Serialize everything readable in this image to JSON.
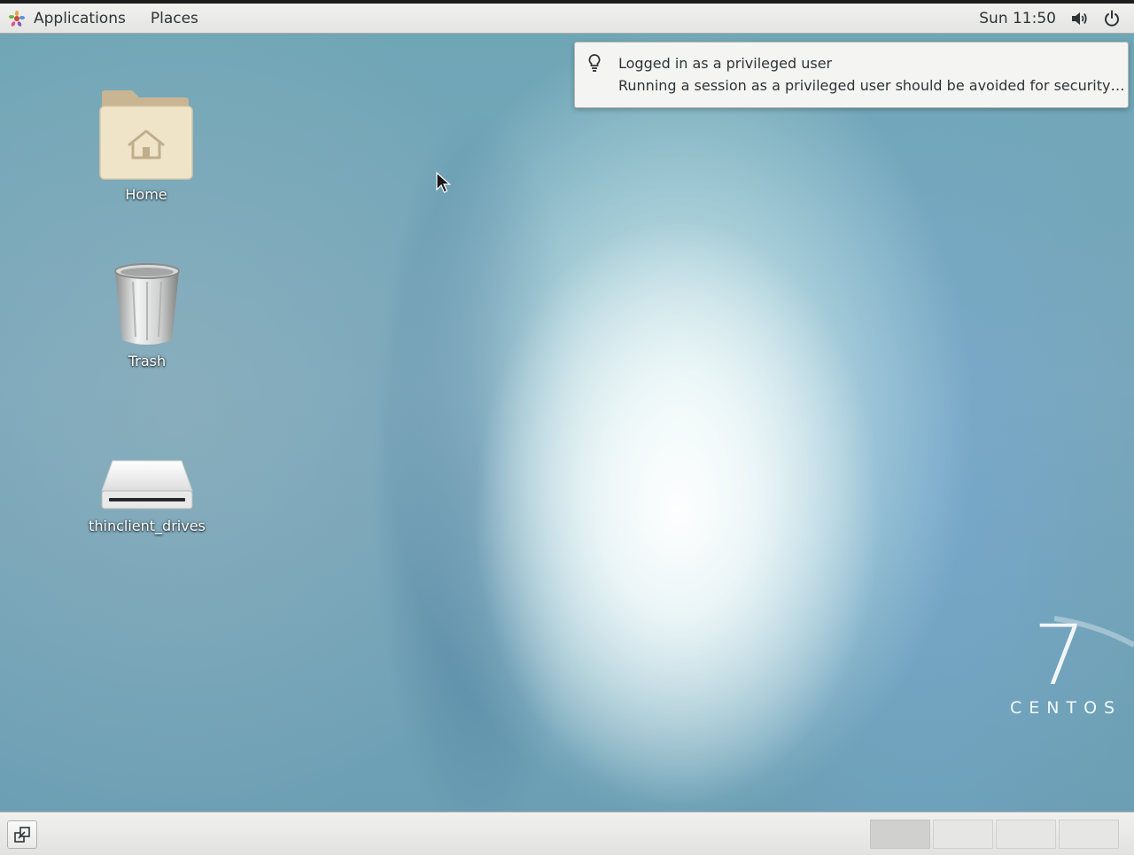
{
  "top_bar": {
    "applications_label": "Applications",
    "places_label": "Places",
    "clock": "Sun 11:50",
    "icons": [
      "gnome-foot-icon",
      "volume-icon",
      "power-icon"
    ]
  },
  "desktop": {
    "icons": [
      {
        "label": "Home",
        "icon": "home-folder-icon"
      },
      {
        "label": "Trash",
        "icon": "trash-icon"
      },
      {
        "label": "thinclient_drives",
        "icon": "drive-icon"
      }
    ],
    "branding": {
      "number": "7",
      "text": "CENTOS"
    }
  },
  "notification": {
    "icon": "lightbulb-icon",
    "title": "Logged in as a privileged user",
    "body": "Running a session as a privileged user should be avoided for security…"
  },
  "bottom_bar": {
    "show_desktop_icon": "show-desktop-icon",
    "workspaces": [
      {
        "active": true
      },
      {
        "active": false
      },
      {
        "active": false
      },
      {
        "active": false
      }
    ]
  }
}
